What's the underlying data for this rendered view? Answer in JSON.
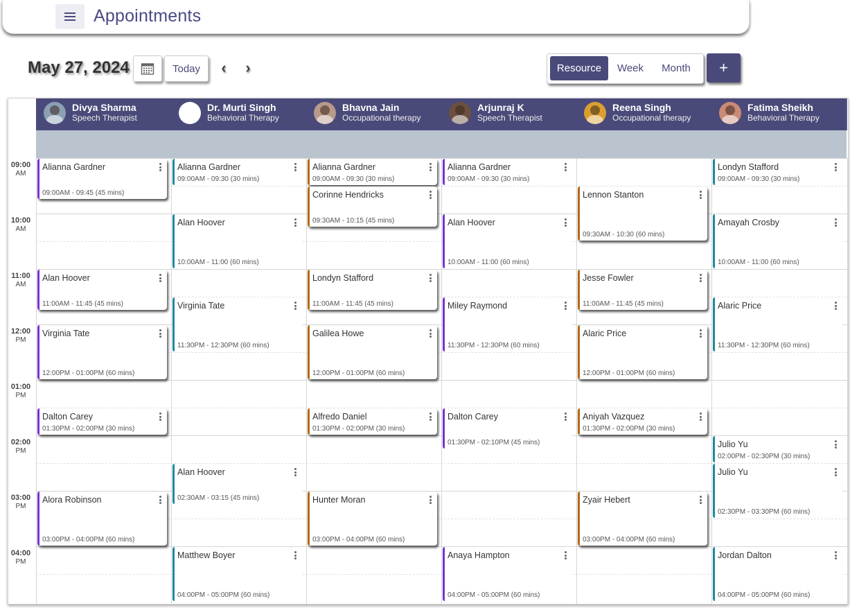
{
  "header": {
    "title": "Appointments",
    "menu_icon": "hamburger-menu-icon"
  },
  "toolbar": {
    "date": "May 27, 2024",
    "today_label": "Today",
    "views": [
      "Resource",
      "Week",
      "Month"
    ],
    "active_view": "Resource",
    "add_label": "+"
  },
  "colors": {
    "primary": "#4a4a7a",
    "purple": "#7a2fd0",
    "brown": "#b26a12",
    "teal": "#1b8a9f",
    "allday": "#bac4cf"
  },
  "resources": [
    {
      "name": "Divya Sharma",
      "role": "Speech Therapist"
    },
    {
      "name": "Dr. Murti Singh",
      "role": "Behavioral Therapy"
    },
    {
      "name": "Bhavna Jain",
      "role": "Occupational therapy"
    },
    {
      "name": "Arjunraj K",
      "role": "Speech Therapist"
    },
    {
      "name": "Reena Singh",
      "role": "Occupational therapy"
    },
    {
      "name": "Fatima Sheikh",
      "role": "Behavioral Therapy"
    }
  ],
  "time_slots": [
    {
      "time": "09:00",
      "ampm": "AM"
    },
    {
      "time": "10:00",
      "ampm": "AM"
    },
    {
      "time": "11:00",
      "ampm": "AM"
    },
    {
      "time": "12:00",
      "ampm": "PM"
    },
    {
      "time": "01:00",
      "ampm": "PM"
    },
    {
      "time": "02:00",
      "ampm": "PM"
    },
    {
      "time": "03:00",
      "ampm": "PM"
    },
    {
      "time": "04:00",
      "ampm": "PM"
    }
  ],
  "appointments": [
    {
      "resource": 0,
      "patient": "Alianna Gardner",
      "time": "09:00AM - 09:45 (45 mins)",
      "color": "purple"
    },
    {
      "resource": 0,
      "patient": "Alan Hoover",
      "time": "11:00AM - 11:45 (45 mins)",
      "color": "purple"
    },
    {
      "resource": 0,
      "patient": "Virginia Tate",
      "time": "12:00PM - 01:00PM (60 mins)",
      "color": "purple"
    },
    {
      "resource": 0,
      "patient": "Dalton Carey",
      "time": "01:30PM - 02:00PM (30 mins)",
      "color": "purple"
    },
    {
      "resource": 0,
      "patient": "Alora Robinson",
      "time": "03:00PM - 04:00PM (60 mins)",
      "color": "purple"
    },
    {
      "resource": 1,
      "patient": "Alianna Gardner",
      "time": "09:00AM - 09:30 (30 mins)",
      "color": "teal"
    },
    {
      "resource": 1,
      "patient": "Alan Hoover",
      "time": "10:00AM - 11:00 (60 mins)",
      "color": "teal"
    },
    {
      "resource": 1,
      "patient": "Virginia Tate",
      "time": "11:30PM - 12:30PM (60 mins)",
      "color": "teal"
    },
    {
      "resource": 1,
      "patient": "Alan Hoover",
      "time": "02:30AM - 03:15 (45 mins)",
      "color": "teal"
    },
    {
      "resource": 1,
      "patient": "Matthew Boyer",
      "time": "04:00PM - 05:00PM (60 mins)",
      "color": "teal"
    },
    {
      "resource": 2,
      "patient": "Alianna Gardner",
      "time": "09:00AM - 09:30 (30 mins)",
      "color": "brown"
    },
    {
      "resource": 2,
      "patient": "Corinne Hendricks",
      "time": "09:30AM - 10:15 (45 mins)",
      "color": "brown"
    },
    {
      "resource": 2,
      "patient": "Londyn Stafford",
      "time": "11:00AM - 11:45 (45 mins)",
      "color": "brown"
    },
    {
      "resource": 2,
      "patient": "Galilea Howe",
      "time": "12:00PM - 01:00PM (60 mins)",
      "color": "brown"
    },
    {
      "resource": 2,
      "patient": "Alfredo Daniel",
      "time": "01:30PM - 02:00PM (30 mins)",
      "color": "brown"
    },
    {
      "resource": 2,
      "patient": "Hunter Moran",
      "time": "03:00PM - 04:00PM (60 mins)",
      "color": "brown"
    },
    {
      "resource": 3,
      "patient": "Alianna Gardner",
      "time": "09:00AM - 09:30 (30 mins)",
      "color": "purple"
    },
    {
      "resource": 3,
      "patient": "Alan Hoover",
      "time": "10:00AM - 11:00 (60 mins)",
      "color": "purple"
    },
    {
      "resource": 3,
      "patient": "Miley Raymond",
      "time": "11:30PM - 12:30PM (60 mins)",
      "color": "purple"
    },
    {
      "resource": 3,
      "patient": "Dalton Carey",
      "time": "01:30PM - 02:10PM (45 mins)",
      "color": "purple"
    },
    {
      "resource": 3,
      "patient": "Anaya Hampton",
      "time": "04:00PM - 05:00PM (60 mins)",
      "color": "purple"
    },
    {
      "resource": 4,
      "patient": "Lennon Stanton",
      "time": "09:30AM - 10:30 (60 mins)",
      "color": "brown"
    },
    {
      "resource": 4,
      "patient": "Jesse Fowler",
      "time": "11:00AM - 11:45 (45 mins)",
      "color": "brown"
    },
    {
      "resource": 4,
      "patient": "Alaric Price",
      "time": "12:00PM - 01:00PM (60 mins)",
      "color": "brown"
    },
    {
      "resource": 4,
      "patient": "Aniyah Vazquez",
      "time": "01:30PM - 02:00PM (30 mins)",
      "color": "brown"
    },
    {
      "resource": 4,
      "patient": "Zyair Hebert",
      "time": "03:00PM - 04:00PM (60 mins)",
      "color": "brown"
    },
    {
      "resource": 5,
      "patient": "Londyn Stafford",
      "time": "09:00AM - 09:30 (30 mins)",
      "color": "teal"
    },
    {
      "resource": 5,
      "patient": "Amayah Crosby",
      "time": "10:00AM - 11:00 (60 mins)",
      "color": "teal"
    },
    {
      "resource": 5,
      "patient": "Alaric Price",
      "time": "11:30PM - 12:30PM (60 mins)",
      "color": "teal"
    },
    {
      "resource": 5,
      "patient": "Julio Yu",
      "time": "02:00PM - 02:30PM (30 mins)",
      "color": "teal"
    },
    {
      "resource": 5,
      "patient": "Julio Yu",
      "time": "02:30PM - 03:30PM (60 mins)",
      "color": "teal"
    },
    {
      "resource": 5,
      "patient": "Jordan Dalton",
      "time": "04:00PM - 05:00PM (60 mins)",
      "color": "teal"
    }
  ]
}
